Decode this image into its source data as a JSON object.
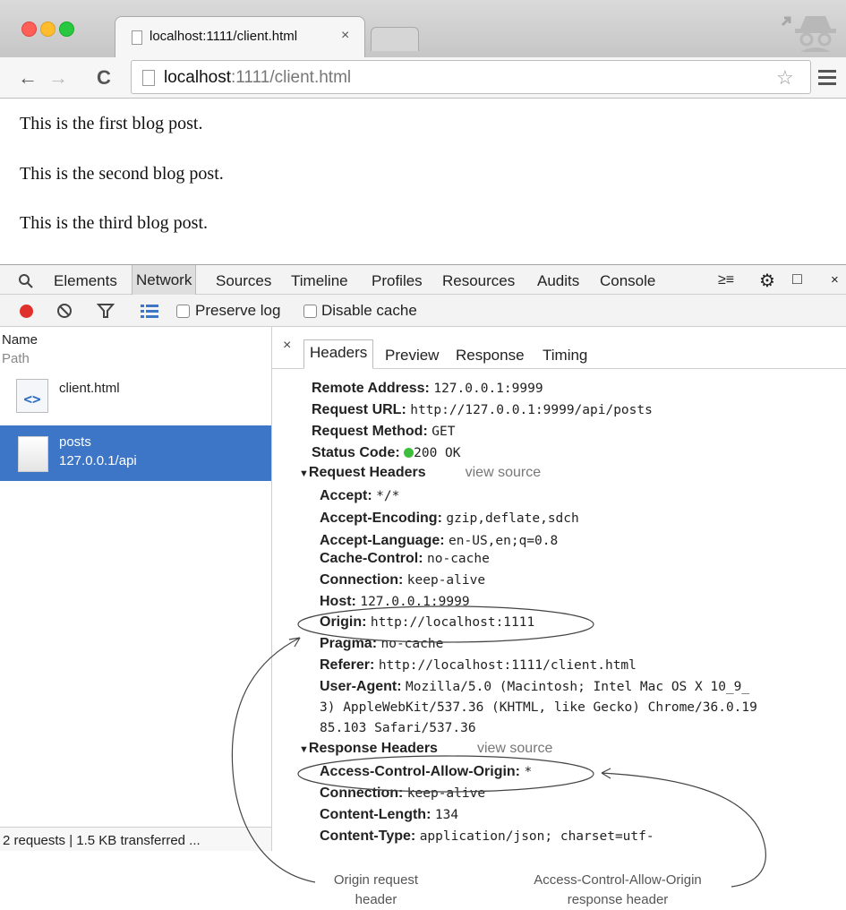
{
  "browser": {
    "tab_title": "localhost:1111/client.html",
    "tab_close": "×",
    "url_host": "localhost",
    "url_rest": ":1111/client.html"
  },
  "page": {
    "paragraphs": [
      "This is the first blog post.",
      "This is the second blog post.",
      "This is the third blog post."
    ]
  },
  "devtools": {
    "tabs": [
      "Elements",
      "Network",
      "Sources",
      "Timeline",
      "Profiles",
      "Resources",
      "Audits",
      "Console"
    ],
    "selected_tab": "Network",
    "close": "×",
    "preserve_log": "Preserve log",
    "disable_cache": "Disable cache",
    "list": {
      "col_name": "Name",
      "col_path": "Path",
      "items": [
        {
          "name": "client.html",
          "path": ""
        },
        {
          "name": "posts",
          "path": "127.0.0.1/api"
        }
      ],
      "footer": "2 requests | 1.5 KB transferred ..."
    },
    "detail_close": "×",
    "detail_tabs": [
      "Headers",
      "Preview",
      "Response",
      "Timing"
    ],
    "general": [
      {
        "k": "Remote Address:",
        "v": "127.0.0.1:9999"
      },
      {
        "k": "Request URL:",
        "v": "http://127.0.0.1:9999/api/posts"
      },
      {
        "k": "Request Method:",
        "v": "GET"
      },
      {
        "k": "Status Code:",
        "v": "200 OK"
      }
    ],
    "request_headers_title": "Request Headers",
    "view_source": "view source",
    "request_headers": [
      {
        "k": "Accept:",
        "v": "*/*"
      },
      {
        "k": "Accept-Encoding:",
        "v": "gzip,deflate,sdch"
      },
      {
        "k": "Accept-Language:",
        "v": "en-US,en;q=0.8"
      },
      {
        "k": "Cache-Control:",
        "v": "no-cache"
      },
      {
        "k": "Connection:",
        "v": "keep-alive"
      },
      {
        "k": "Host:",
        "v": "127.0.0.1:9999"
      },
      {
        "k": "Origin:",
        "v": "http://localhost:1111"
      },
      {
        "k": "Pragma:",
        "v": "no-cache"
      },
      {
        "k": "Referer:",
        "v": "http://localhost:1111/client.html"
      },
      {
        "k": "User-Agent:",
        "v": "Mozilla/5.0 (Macintosh; Intel Mac OS X 10_9_"
      }
    ],
    "ua_cont1": "3) AppleWebKit/537.36 (KHTML, like Gecko) Chrome/36.0.19",
    "ua_cont2": "85.103 Safari/537.36",
    "response_headers_title": "Response Headers",
    "response_headers": [
      {
        "k": "Access-Control-Allow-Origin:",
        "v": "*"
      },
      {
        "k": "Connection:",
        "v": "keep-alive"
      },
      {
        "k": "Content-Length:",
        "v": "134"
      },
      {
        "k": "Content-Type:",
        "v": "application/json; charset=utf-"
      }
    ]
  },
  "callouts": {
    "origin_line1": "Origin request",
    "origin_line2": "header",
    "acao_line1": "Access-Control-Allow-Origin",
    "acao_line2": "response header"
  },
  "colors": {
    "record_red": "#e0302b",
    "status_green": "#3cbf3c",
    "selected_row": "#3d76c7",
    "traffic_red": "#ff5f57",
    "traffic_yellow": "#ffbd2e",
    "traffic_green": "#28c941"
  }
}
